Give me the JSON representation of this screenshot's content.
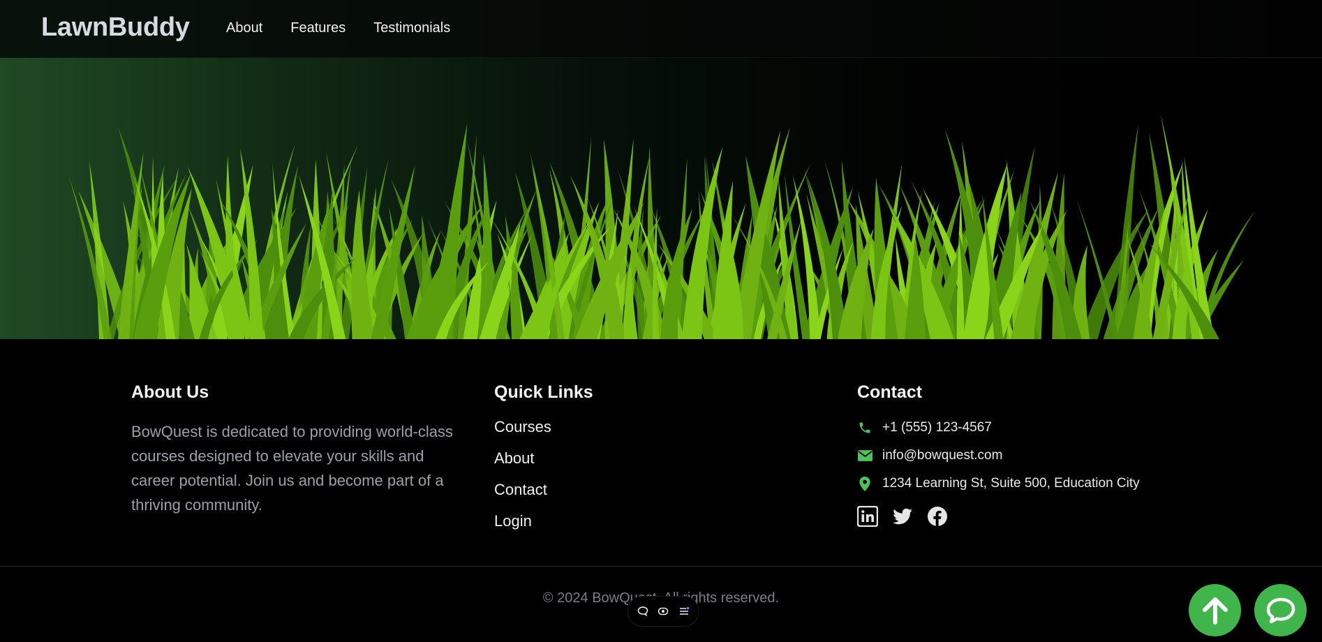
{
  "nav": {
    "brand": "LawnBuddy",
    "links": [
      "About",
      "Features",
      "Testimonials"
    ]
  },
  "hero": {
    "image": "grass-illustration",
    "colors": {
      "grass_light": "#8ad41a",
      "grass_mid": "#6fb212",
      "grass_dark": "#4d8f0c",
      "bg_left": "#1f4a24"
    }
  },
  "footer": {
    "about": {
      "heading": "About Us",
      "text": "BowQuest is dedicated to providing world-class courses designed to elevate your skills and career potential. Join us and become part of a thriving community."
    },
    "quick_links": {
      "heading": "Quick Links",
      "items": [
        "Courses",
        "About",
        "Contact",
        "Login"
      ]
    },
    "contact": {
      "heading": "Contact",
      "phone": "+1 (555) 123-4567",
      "email": "info@bowquest.com",
      "address": "1234 Learning St, Suite 500, Education City",
      "icons": [
        "phone-icon",
        "envelope-icon",
        "map-pin-icon"
      ],
      "socials": [
        "linkedin-icon",
        "twitter-icon",
        "facebook-icon"
      ]
    },
    "copyright": "© 2024 BowQuest. All rights reserved."
  },
  "mini_toolbar": {
    "icons": [
      "comment-icon",
      "eye-icon",
      "list-icon"
    ]
  },
  "fabs": {
    "icons": [
      "arrow-up-icon",
      "chat-bubble-icon"
    ],
    "accent": "#3fb54b"
  }
}
